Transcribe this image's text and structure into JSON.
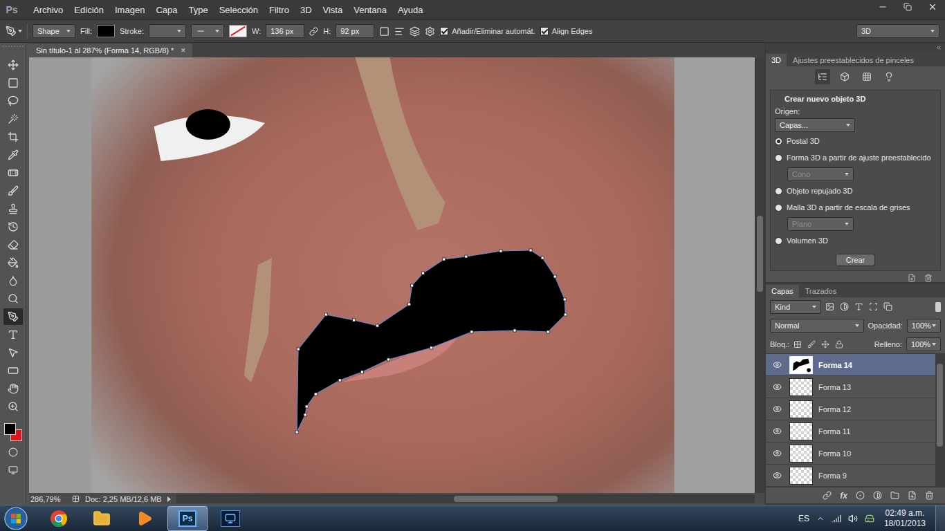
{
  "app_logo": "Ps",
  "menu": [
    "Archivo",
    "Edición",
    "Imagen",
    "Capa",
    "Type",
    "Selección",
    "Filtro",
    "3D",
    "Vista",
    "Ventana",
    "Ayuda"
  ],
  "options_bar": {
    "tool_mode": "Shape",
    "fill_label": "Fill:",
    "fill_color": "#000000",
    "stroke_label": "Stroke:",
    "stroke_none": true,
    "width_label": "W:",
    "width": "136 px",
    "height_label": "H:",
    "height": "92 px",
    "checkboxes": [
      {
        "label": "Añadir/Eliminar automát.",
        "checked": true
      },
      {
        "label": "Align Edges",
        "checked": true
      }
    ],
    "workspace": "3D"
  },
  "document_tab": {
    "title": "Sin título-1 al 287% (Forma 14, RGB/8) *",
    "close": "×"
  },
  "tools": [
    {
      "kind": "move",
      "selected": false
    },
    {
      "kind": "marquee",
      "selected": false
    },
    {
      "kind": "lasso",
      "selected": false
    },
    {
      "kind": "wand",
      "selected": false
    },
    {
      "kind": "crop",
      "selected": false
    },
    {
      "kind": "eyedropper",
      "selected": false
    },
    {
      "kind": "heal",
      "selected": false
    },
    {
      "kind": "brush",
      "selected": false
    },
    {
      "kind": "stamp",
      "selected": false
    },
    {
      "kind": "history",
      "selected": false
    },
    {
      "kind": "eraser",
      "selected": false
    },
    {
      "kind": "bucket",
      "selected": false
    },
    {
      "kind": "blur",
      "selected": false
    },
    {
      "kind": "dodge",
      "selected": false
    },
    {
      "kind": "pen",
      "selected": true
    },
    {
      "kind": "type",
      "selected": false
    },
    {
      "kind": "path-select",
      "selected": false
    },
    {
      "kind": "shape",
      "selected": false
    },
    {
      "kind": "hand",
      "selected": false
    },
    {
      "kind": "zoom",
      "selected": false
    }
  ],
  "colors": {
    "foreground": "#000000",
    "background": "#e3131b"
  },
  "canvas": {
    "vertical_scroll": {
      "level": 0.45
    },
    "horizontal_scroll": {
      "level": 0.57
    }
  },
  "status_bar": {
    "zoom": "286,79%",
    "doc": "Doc: 2,25 MB/12,6 MB"
  },
  "panel_3d": {
    "tabs": [
      {
        "label": "3D",
        "selected": true
      },
      {
        "label": "Ajustes preestablecidos de pinceles",
        "selected": false
      }
    ],
    "heading": "Crear nuevo objeto 3D",
    "source_label": "Origen:",
    "source": "Capas...",
    "options": [
      {
        "kind": "radio",
        "label": "Postal 3D",
        "selected": true,
        "disabled": false
      },
      {
        "kind": "radio",
        "label": "Forma 3D a partir de ajuste preestablecido",
        "selected": false,
        "disabled": false
      },
      {
        "kind": "select",
        "label": "Cono",
        "selected": false,
        "disabled": true
      },
      {
        "kind": "radio",
        "label": "Objeto repujado 3D",
        "selected": false,
        "disabled": false
      },
      {
        "kind": "radio",
        "label": "Malla 3D a partir de escala de grises",
        "selected": false,
        "disabled": false
      },
      {
        "kind": "select",
        "label": "Plano",
        "selected": false,
        "disabled": true
      },
      {
        "kind": "radio",
        "label": "Volumen 3D",
        "selected": false,
        "disabled": false
      }
    ],
    "button": "Crear"
  },
  "layers_panel": {
    "tabs": [
      {
        "label": "Capas",
        "selected": true
      },
      {
        "label": "Trazados",
        "selected": false
      }
    ],
    "filter": "Kind",
    "blend_mode": "Normal",
    "opacity_label": "Opacidad:",
    "opacity": "100%",
    "lock_label": "Bloq.:",
    "fill_label": "Relleno:",
    "fill": "100%",
    "fx_label": "fx",
    "layers": [
      {
        "name": "Forma 14",
        "visible": true,
        "selected": true,
        "kind": "filled"
      },
      {
        "name": "Forma 13",
        "visible": true,
        "selected": false,
        "kind": "empty"
      },
      {
        "name": "Forma 12",
        "visible": true,
        "selected": false,
        "kind": "empty"
      },
      {
        "name": "Forma 11",
        "visible": true,
        "selected": false,
        "kind": "empty"
      },
      {
        "name": "Forma 10",
        "visible": true,
        "selected": false,
        "kind": "empty"
      },
      {
        "name": "Forma 9",
        "visible": true,
        "selected": false,
        "kind": "empty"
      }
    ]
  },
  "taskbar": {
    "apps": [
      {
        "kind": "chrome",
        "selected": false
      },
      {
        "kind": "explorer",
        "selected": false
      },
      {
        "kind": "media",
        "selected": false
      },
      {
        "kind": "photoshop",
        "selected": true,
        "label": "Ps"
      },
      {
        "kind": "monitor",
        "selected": false
      }
    ],
    "language": "ES",
    "time": "02:49 a.m.",
    "date": "18/01/2013"
  }
}
